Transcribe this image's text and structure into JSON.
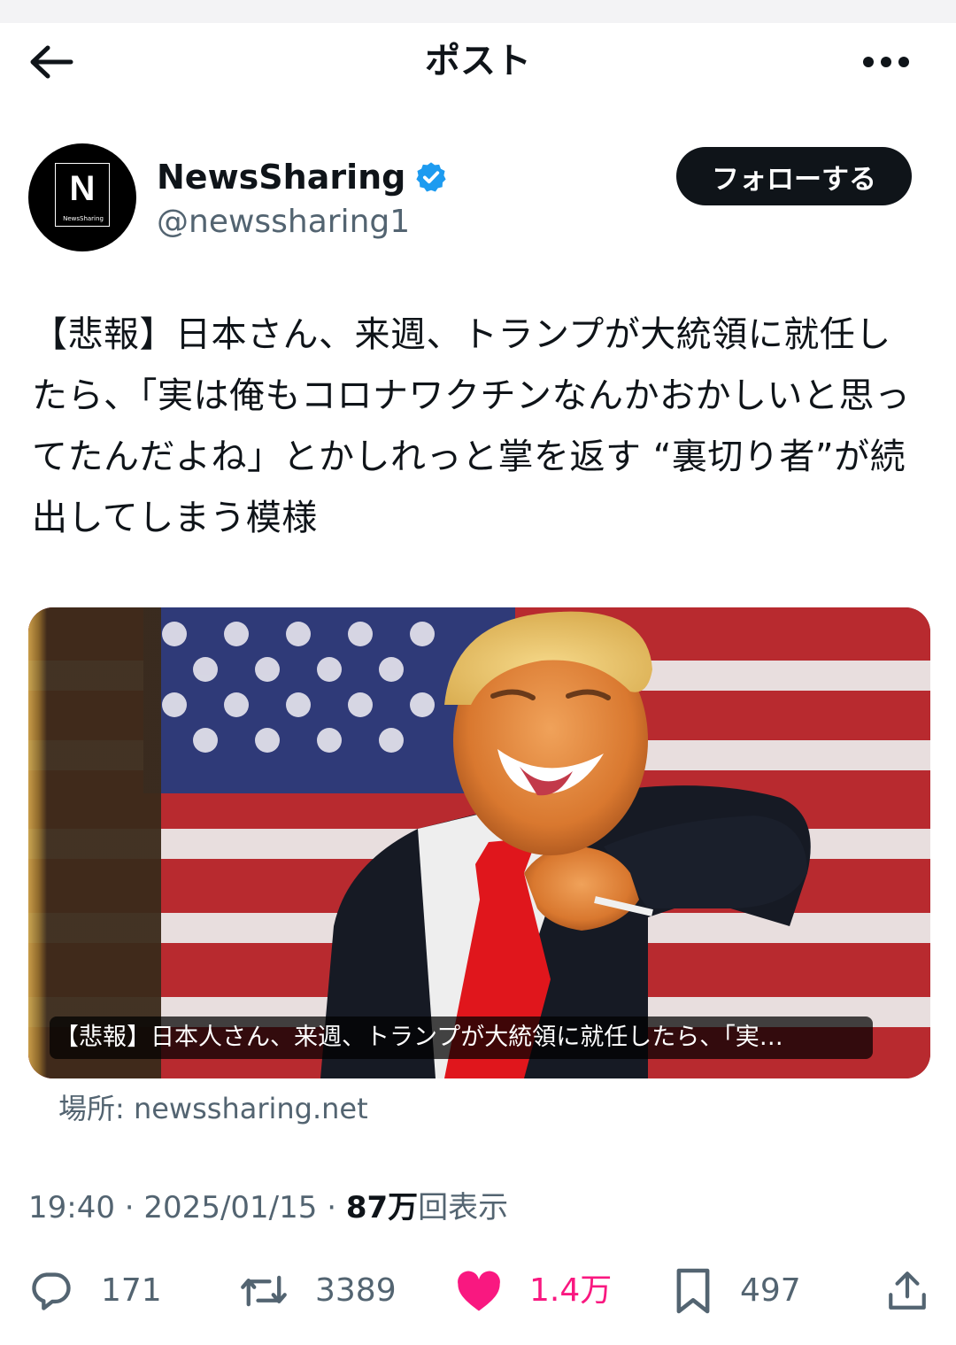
{
  "header": {
    "title": "ポスト"
  },
  "author": {
    "display_name": "NewsSharing",
    "handle": "@newssharing1",
    "avatar_letter": "N",
    "avatar_subtext": "NewsSharing",
    "follow_label": "フォローする"
  },
  "post": {
    "text": "【悲報】日本さん、来週、トランプが大統領に就任したら、「実は俺もコロナワクチンなんかおかしいと思ってたんだよね」とかしれっと掌を返す “裏切り者”が続出してしまう模様"
  },
  "link_card": {
    "caption": "【悲報】日本人さん、来週、トランプが大統領に就任したら、「実…",
    "source_label": "場所: newssharing.net"
  },
  "meta": {
    "time": "19:40",
    "separator": " · ",
    "date": "2025/01/15",
    "views_number": "87万",
    "views_label": "回表示"
  },
  "actions": {
    "reply_count": "171",
    "repost_count": "3389",
    "like_count": "1.4万",
    "bookmark_count": "497"
  },
  "colors": {
    "text_primary": "#0f1419",
    "text_secondary": "#536471",
    "like_pink": "#f91880",
    "verified_blue": "#1d9bf0"
  },
  "icons": [
    "back-arrow-icon",
    "more-icon",
    "verified-badge-icon",
    "reply-icon",
    "repost-icon",
    "like-icon",
    "bookmark-icon",
    "share-icon"
  ]
}
